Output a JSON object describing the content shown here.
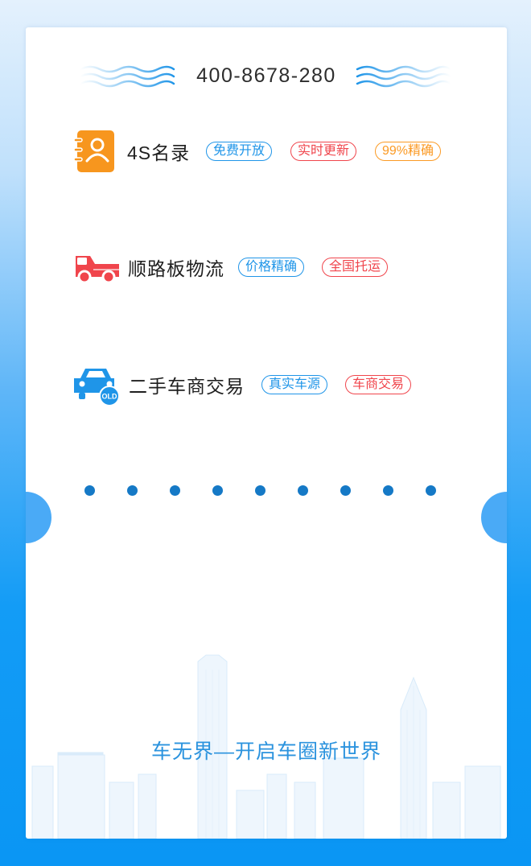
{
  "contact": {
    "phone": "400-8678-280"
  },
  "features": [
    {
      "title": "4S名录",
      "icon": "contact-book-icon",
      "tags": [
        {
          "label": "免费开放",
          "color": "blue"
        },
        {
          "label": "实时更新",
          "color": "red"
        },
        {
          "label": "99%精确",
          "color": "orange"
        }
      ]
    },
    {
      "title": "顺路板物流",
      "icon": "truck-icon",
      "tags": [
        {
          "label": "价格精确",
          "color": "blue"
        },
        {
          "label": "全国托运",
          "color": "red"
        }
      ]
    },
    {
      "title": "二手车商交易",
      "icon": "old-car-icon",
      "old_badge": "OLD",
      "tags": [
        {
          "label": "真实车源",
          "color": "blue"
        },
        {
          "label": "车商交易",
          "color": "red"
        }
      ]
    }
  ],
  "slogan": "车无界—开启车圈新世界",
  "colors": {
    "blue": "#1f95e8",
    "red": "#f0454c",
    "orange": "#fb9a24",
    "dot": "#1579c6"
  }
}
